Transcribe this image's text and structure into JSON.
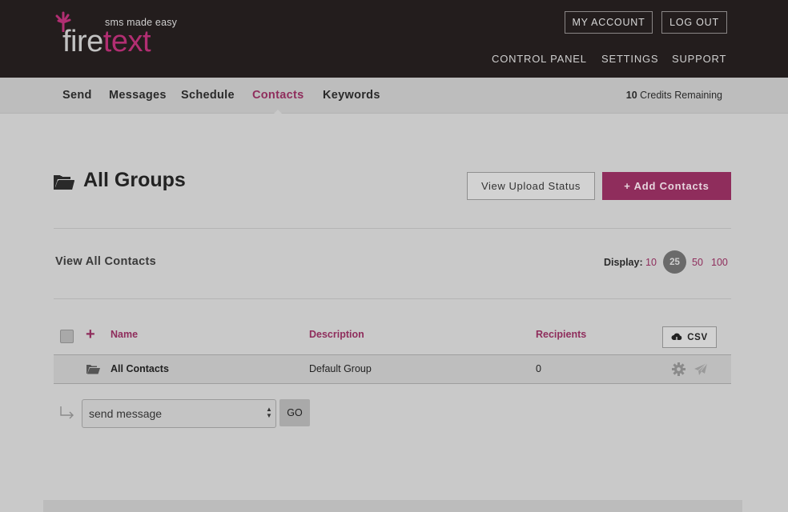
{
  "brand": {
    "tagline": "sms made easy",
    "word_part1": "fire",
    "word_part2": "text"
  },
  "header": {
    "my_account": "MY ACCOUNT",
    "log_out": "LOG OUT",
    "nav": [
      "CONTROL PANEL",
      "SETTINGS",
      "SUPPORT"
    ]
  },
  "subnav": {
    "items": [
      "Send",
      "Messages",
      "Schedule",
      "Contacts",
      "Keywords"
    ],
    "active": "Contacts",
    "credits_count": "10",
    "credits_label": "Credits Remaining"
  },
  "page": {
    "title": "All Groups",
    "view_upload_status": "View Upload Status",
    "add_contacts": "+ Add Contacts"
  },
  "contacts": {
    "section_title": "View All Contacts",
    "display_label": "Display:",
    "display_options": [
      "10",
      "25",
      "50",
      "100"
    ],
    "display_selected": "25"
  },
  "table": {
    "add_symbol": "+",
    "columns": [
      "Name",
      "Description",
      "Recipients"
    ],
    "csv_label": "CSV",
    "rows": [
      {
        "name": "All Contacts",
        "description": "Default Group",
        "recipients": "0"
      }
    ]
  },
  "bulk": {
    "action_value": "send message",
    "go_label": "GO"
  },
  "colors": {
    "brand": "#b12e72",
    "header_bg": "#231d1d",
    "overlay_bg": "#c9c9c9"
  },
  "icons": [
    "leaf-icon",
    "folder-open-icon",
    "cloud-download-icon",
    "gear-icon",
    "paper-plane-icon",
    "return-arrow-icon"
  ]
}
